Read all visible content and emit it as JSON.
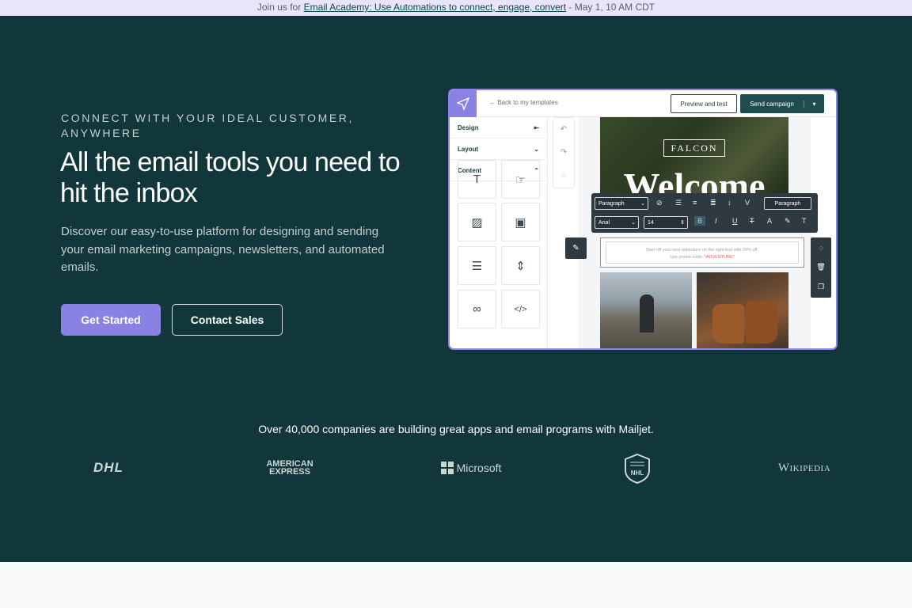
{
  "announcement": {
    "prefix": "Join us for ",
    "link_text": "Email Academy: Use Automations to connect, engage, convert",
    "suffix": " - May 1, 10 AM CDT"
  },
  "hero": {
    "eyebrow": "CONNECT WITH YOUR IDEAL CUSTOMER, ANYWHERE",
    "headline": "All the email tools you need to hit the inbox",
    "subheadline": "Discover our easy-to-use platform for designing and sending your email marketing campaigns, newsletters, and automated emails.",
    "cta_primary": "Get Started",
    "cta_secondary": "Contact Sales"
  },
  "mockup": {
    "back_link": "Back to my templates",
    "preview_button": "Preview and test",
    "send_button": "Send campaign",
    "sidebar": [
      {
        "label": "Design",
        "icon": "collapse-icon"
      },
      {
        "label": "Layout",
        "icon": "chevron-down-icon"
      },
      {
        "label": "Content",
        "icon": "chevron-up-icon"
      }
    ],
    "content_blocks": [
      "text-block-icon",
      "button-block-icon",
      "image-block-icon",
      "video-block-icon",
      "section-block-icon",
      "spacer-block-icon",
      "social-block-icon",
      "code-block-icon"
    ],
    "brand_name": "FALCON",
    "hero_word": "Welcome",
    "toolbar": {
      "style_select": "Paragraph",
      "style_label": "Paragraph",
      "font_select": "Arial",
      "size_input": "14"
    },
    "body_text_line1": "Start off your next adventure on the right foot with 20% off.",
    "body_text_line2_prefix": "Use promo code: ",
    "promo_code": "*ADVENTURE*"
  },
  "trust": {
    "text": "Over 40,000 companies are building great apps and email programs with Mailjet.",
    "logos": {
      "dhl": "DHL",
      "amex_line1": "AMERICAN",
      "amex_line2": "EXPRESS",
      "microsoft": "Microsoft",
      "nhl": "NHL",
      "wikipedia": "Wikipedia"
    }
  },
  "colors": {
    "hero_bg": "#12373a",
    "accent": "#8a82e3",
    "announce_bg": "#e9e4fb",
    "link": "#0d4a48"
  }
}
